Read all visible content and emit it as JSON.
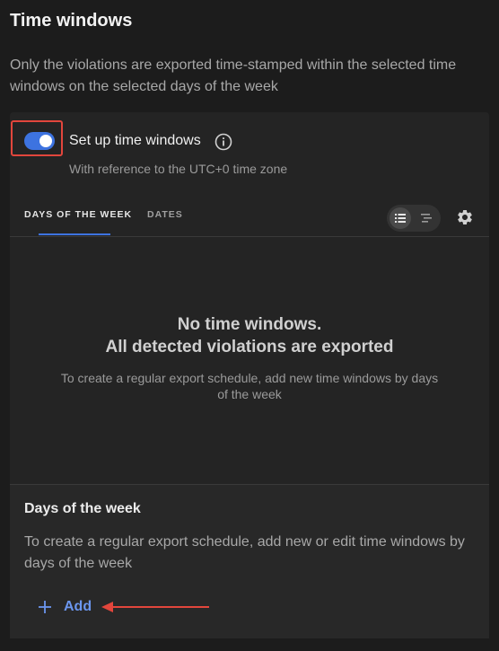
{
  "header": {
    "title": "Time windows",
    "description": "Only the violations are exported time-stamped within the selected time windows on the selected days of the week"
  },
  "setup": {
    "label": "Set up time windows",
    "enabled": true,
    "subtitle": "With reference to the UTC+0 time zone"
  },
  "tabs": [
    {
      "label": "DAYS OF THE WEEK",
      "active": true
    },
    {
      "label": "DATES",
      "active": false
    }
  ],
  "empty_state": {
    "title_line1": "No time windows.",
    "title_line2": "All detected violations are exported",
    "description": "To create a regular export schedule, add new time windows by days of the week"
  },
  "days_section": {
    "title": "Days of the week",
    "description": "To create a regular export schedule, add new or edit time windows by days of the week",
    "add_label": "Add"
  },
  "colors": {
    "accent": "#3d73e0",
    "link": "#6b96ee",
    "highlight": "#e2463c"
  },
  "icons": {
    "info": "info-icon",
    "list_view": "list-view-icon",
    "timeline_view": "timeline-view-icon",
    "settings": "gear-icon",
    "add": "plus-icon"
  }
}
